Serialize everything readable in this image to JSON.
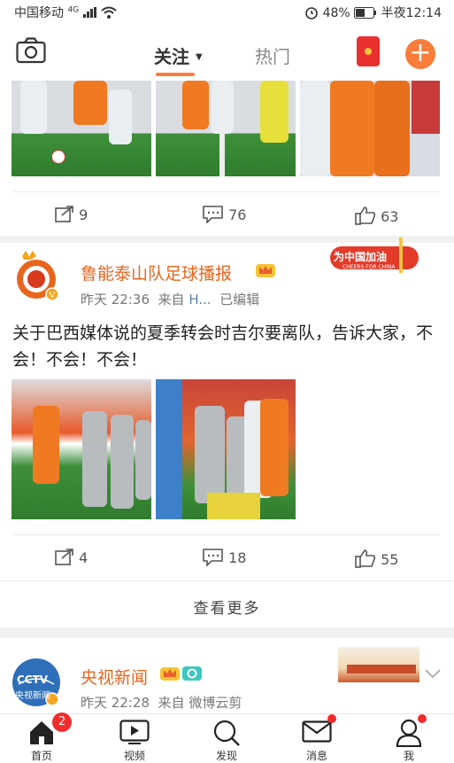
{
  "status_bar": {
    "carrier": "中国移动",
    "network": "4G",
    "battery": "48%",
    "time": "半夜12:14"
  },
  "nav": {
    "tab_follow": "关注",
    "tab_hot": "热门"
  },
  "post1": {
    "repost_count": "9",
    "comment_count": "76",
    "like_count": "63"
  },
  "post2": {
    "author": "鲁能泰山队足球播报",
    "time": "昨天 22:36",
    "source_prefix": "来自",
    "source": "H...",
    "edited": "已编辑",
    "text": "关于巴西媒体说的夏季转会时吉尔要离队，告诉大家，不会！不会！不会！",
    "badge_text": "为中国加油",
    "badge_sub": "CHEERS FOR CHINA",
    "repost_count": "4",
    "comment_count": "18",
    "like_count": "55"
  },
  "see_more": "查看更多",
  "post3": {
    "author": "央视新闻",
    "avatar_text": "CCTV",
    "avatar_sub": "央视新闻",
    "time": "昨天 22:28",
    "source_prefix": "来自",
    "source": "微博云剪"
  },
  "bottom_nav": {
    "home": "首页",
    "home_badge": "2",
    "video": "视频",
    "discover": "发现",
    "messages": "消息",
    "me": "我"
  },
  "colors": {
    "accent": "#fa7d3c",
    "username": "#e8651e",
    "badge": "#f32b2b"
  }
}
